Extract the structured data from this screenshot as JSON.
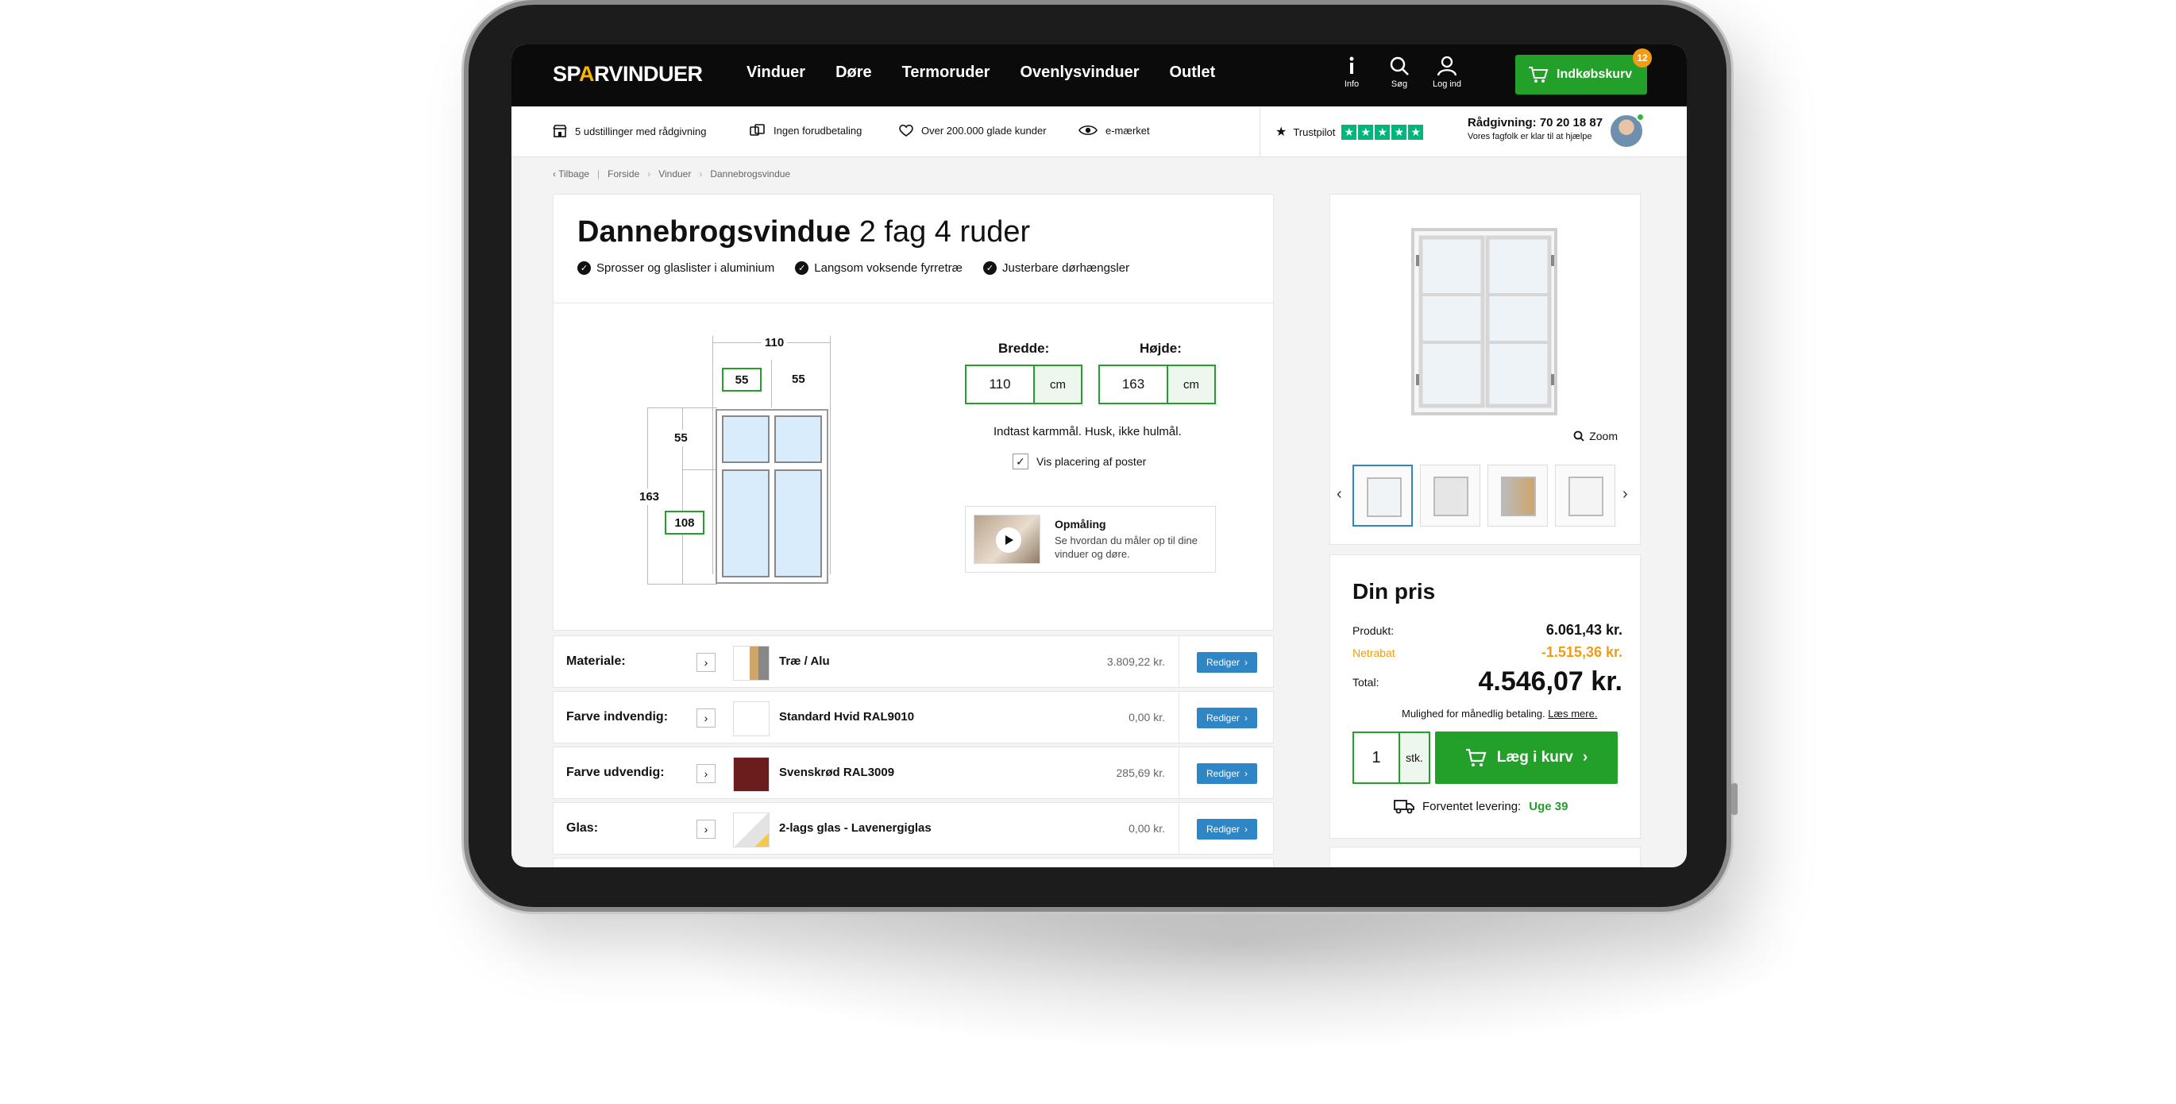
{
  "header": {
    "logo_pre": "SP",
    "logo_accent": "A",
    "logo_post": "RVINDUER",
    "nav": [
      "Vinduer",
      "Døre",
      "Termoruder",
      "Ovenlysvinduer",
      "Outlet"
    ],
    "info_label": "Info",
    "search_label": "Søg",
    "login_label": "Log ind",
    "cart_label": "Indkøbskurv",
    "cart_count": "12"
  },
  "usp": {
    "items": [
      "5 udstillinger med rådgivning",
      "Ingen forudbetaling",
      "Over 200.000 glade kunder",
      "e-mærket"
    ],
    "trustpilot": "Trustpilot",
    "advice_phone": "Rådgivning: 70 20 18 87",
    "advice_sub": "Vores fagfolk er klar til at hjælpe"
  },
  "breadcrumb": {
    "back": "Tilbage",
    "items": [
      "Forside",
      "Vinduer",
      "Dannebrogsvindue"
    ]
  },
  "product": {
    "title_bold": "Dannebrogsvindue",
    "title_rest": " 2 fag 4 ruder",
    "features": [
      "Sprosser og glaslister i aluminium",
      "Langsom voksende fyrretræ",
      "Justerbare dørhængsler"
    ]
  },
  "diagram": {
    "width_total": "110",
    "width_left": "55",
    "width_right": "55",
    "height_top": "55",
    "height_total": "163",
    "height_bottom": "108"
  },
  "dimensions": {
    "width_label": "Bredde:",
    "width_value": "110",
    "height_label": "Højde:",
    "height_value": "163",
    "unit": "cm",
    "hint": "Indtast karmmål. Husk, ikke hulmål.",
    "checkbox_label": "Vis placering af poster",
    "checkbox_checked": "✓"
  },
  "video": {
    "title": "Opmåling",
    "subtitle": "Se hvordan du måler op til dine vinduer og døre."
  },
  "options": [
    {
      "label": "Materiale:",
      "name": "Træ / Alu",
      "price": "3.809,22 kr.",
      "swatch": "#ffffff"
    },
    {
      "label": "Farve indvendig:",
      "name": "Standard Hvid RAL9010",
      "price": "0,00 kr.",
      "swatch": "#ffffff"
    },
    {
      "label": "Farve udvendig:",
      "name": "Svenskrød RAL3009",
      "price": "285,69 kr.",
      "swatch": "#6b1c1c"
    },
    {
      "label": "Glas:",
      "name": "2-lags glas - Lavenergiglas",
      "price": "0,00 kr.",
      "swatch": "#ffffff"
    }
  ],
  "edit_label": "Rediger",
  "gallery": {
    "zoom_label": "Zoom"
  },
  "price": {
    "title": "Din pris",
    "product_label": "Produkt:",
    "product_value": "6.061,43 kr.",
    "discount_label": "Netrabat",
    "discount_value": "-1.515,36 kr.",
    "total_label": "Total:",
    "total_value": "4.546,07 kr.",
    "monthly_text": "Mulighed for månedlig betaling.",
    "monthly_link": "Læs mere.",
    "qty": "1",
    "qty_unit": "stk.",
    "add_label": "Læg i kurv",
    "delivery_label": "Forventet levering:",
    "delivery_value": "Uge 39"
  },
  "colors": {
    "brand_green": "#23a02a",
    "accent_orange": "#f39c12",
    "edit_blue": "#2f86c7",
    "trustpilot_green": "#00b67a"
  }
}
